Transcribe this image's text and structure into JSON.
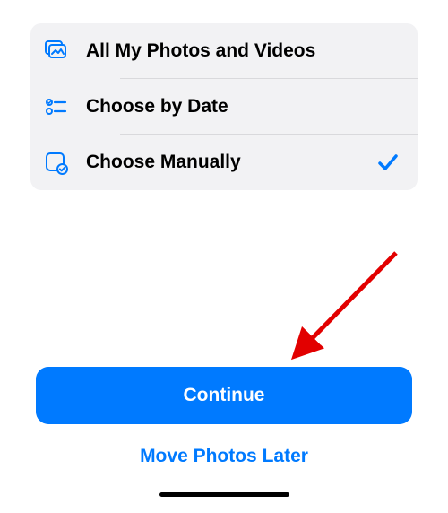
{
  "options": [
    {
      "label": "All My Photos and Videos",
      "icon": "photos-icon",
      "selected": false
    },
    {
      "label": "Choose by Date",
      "icon": "list-icon",
      "selected": false
    },
    {
      "label": "Choose Manually",
      "icon": "manual-icon",
      "selected": true
    }
  ],
  "buttons": {
    "continue_label": "Continue",
    "later_label": "Move Photos Later"
  },
  "colors": {
    "accent": "#007aff",
    "list_bg": "#f2f2f4"
  }
}
